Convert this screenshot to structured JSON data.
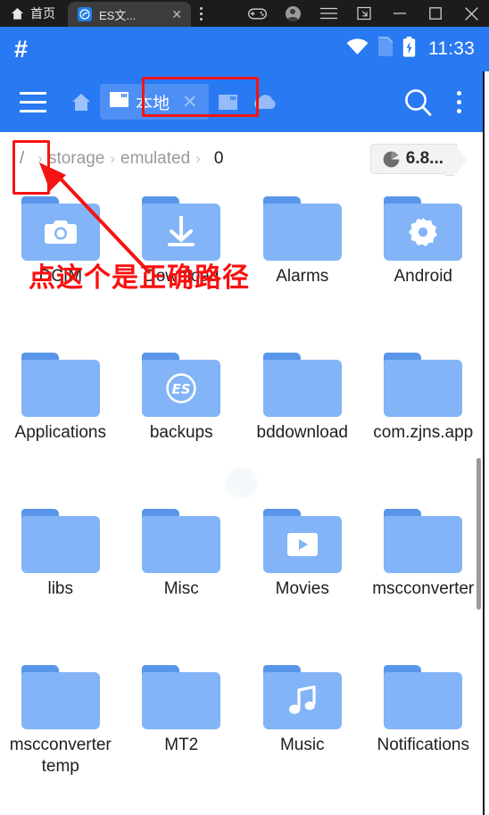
{
  "window": {
    "home_tab_label": "首页",
    "home_icon": "home-icon",
    "active_tab": {
      "label": "ES文...",
      "icon": "es-file-explorer-icon",
      "close_label": "✕"
    },
    "tab_overflow_icon": "vertical-dots-icon",
    "controls": [
      {
        "name": "gamepad-icon",
        "label": ""
      },
      {
        "name": "account-avatar-icon",
        "label": ""
      },
      {
        "name": "menu-icon",
        "label": ""
      },
      {
        "name": "resize-icon",
        "label": ""
      },
      {
        "name": "minimize-icon",
        "label": "—"
      },
      {
        "name": "maximize-icon",
        "label": "□"
      },
      {
        "name": "close-icon",
        "label": "✕"
      }
    ]
  },
  "status_bar": {
    "left_glyph": "#",
    "wifi_icon": "wifi-icon",
    "sim_icon": "sim-card-icon",
    "battery_icon": "battery-charging-icon",
    "time": "11:33"
  },
  "toolbar": {
    "menu_icon": "hamburger-menu-icon",
    "home_icon": "home-icon",
    "location_tab": {
      "label": "本地",
      "icon": "sdcard-icon",
      "close_label": "✕"
    },
    "sdcard_icon": "sdcard-icon",
    "cloud_icon": "cloud-icon",
    "search_icon": "search-icon",
    "overflow_icon": "vertical-dots-icon"
  },
  "breadcrumb": {
    "separator": "›",
    "items": [
      {
        "label": "/",
        "current": false
      },
      {
        "label": "storage",
        "current": false
      },
      {
        "label": "emulated",
        "current": false
      },
      {
        "label": "0",
        "current": true
      }
    ],
    "storage_badge": {
      "label": "6.8...",
      "icon": "pie-chart-icon"
    }
  },
  "annotations": {
    "accent_color": "#f41414",
    "text": "点这个是正确路径",
    "highlight_targets": [
      "location-tab",
      "breadcrumb-root"
    ]
  },
  "files": [
    {
      "name": "DCIM",
      "icon": "camera-icon"
    },
    {
      "name": "Download",
      "icon": "download-icon"
    },
    {
      "name": "Alarms",
      "icon": "none"
    },
    {
      "name": "Android",
      "icon": "gear-icon"
    },
    {
      "name": "Applications",
      "icon": "none"
    },
    {
      "name": "backups",
      "icon": "es-logo-icon"
    },
    {
      "name": "bddownload",
      "icon": "none"
    },
    {
      "name": "com.zjns.app",
      "icon": "none"
    },
    {
      "name": "libs",
      "icon": "none"
    },
    {
      "name": "Misc",
      "icon": "none"
    },
    {
      "name": "Movies",
      "icon": "play-icon"
    },
    {
      "name": "mscconverter",
      "icon": "none"
    },
    {
      "name": "mscconvertertemp",
      "icon": "none"
    },
    {
      "name": "MT2",
      "icon": "none"
    },
    {
      "name": "Music",
      "icon": "music-note-icon"
    },
    {
      "name": "Notifications",
      "icon": "none"
    }
  ],
  "colors": {
    "brand_blue": "#2979f2",
    "folder_blue": "#82b4f7",
    "folder_tab_blue": "#5996ea",
    "annotation_red": "#f41414"
  }
}
